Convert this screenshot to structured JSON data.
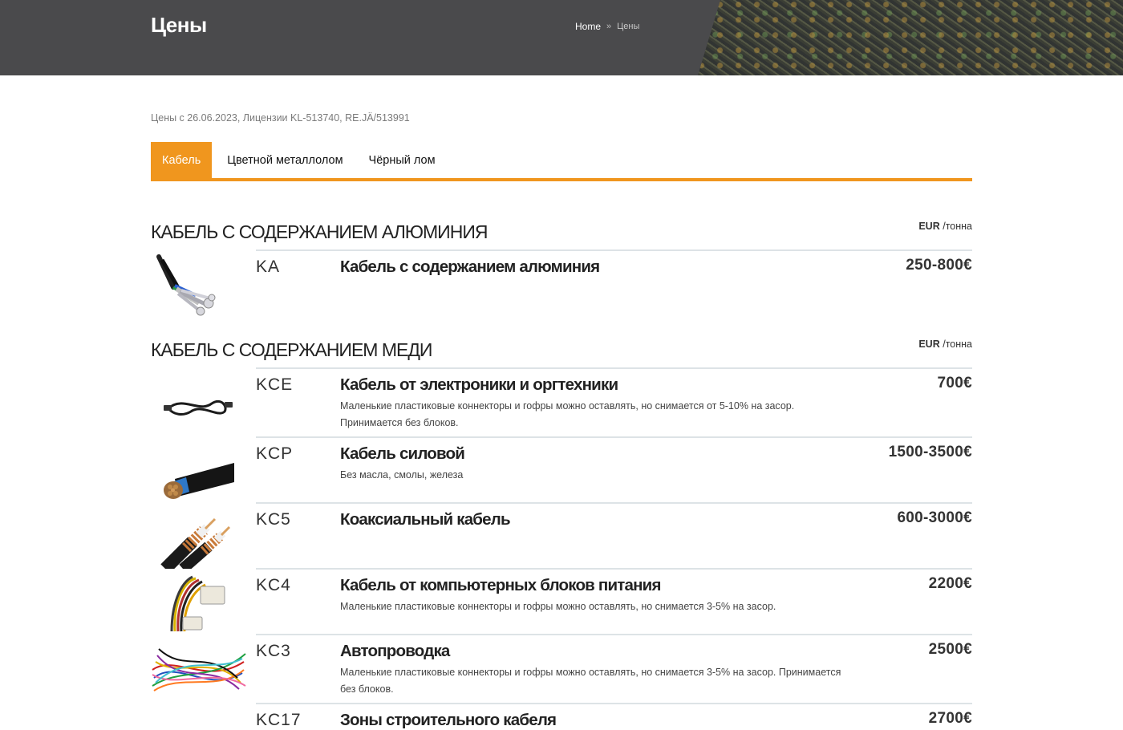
{
  "header": {
    "title": "Цены",
    "breadcrumb": {
      "home": "Home",
      "separator": "»",
      "current": "Цены"
    }
  },
  "license_text": "Цены с 26.06.2023, Лицензии KL-513740, RE.JÄ/513991",
  "tabs": [
    {
      "label": "Кабель",
      "active": true
    },
    {
      "label": "Цветной металлолом",
      "active": false
    },
    {
      "label": "Чёрный лом",
      "active": false
    }
  ],
  "colors": {
    "accent": "#f0961e",
    "header_bg": "#4a4a4c"
  },
  "sections": [
    {
      "title": "КАБЕЛЬ С СОДЕРЖАНИЕМ АЛЮМИНИЯ",
      "unit_currency": "EUR",
      "unit_per": "/тонна",
      "items": [
        {
          "code": "KA",
          "name": "Кабель с содержанием алюминия",
          "description": "",
          "price": "250-800€",
          "image": "aluminium-cable-image"
        }
      ]
    },
    {
      "title": "КАБЕЛЬ С СОДЕРЖАНИЕМ МЕДИ",
      "unit_currency": "EUR",
      "unit_per": "/тонна",
      "items": [
        {
          "code": "KCE",
          "name": "Кабель от электроники и оргтехники",
          "description": "Маленькие пластиковые коннекторы и гофры можно оставлять, но снимается от 5-10% на засор. Принимается без блоков.",
          "price": "700€",
          "image": "electronics-cable-image"
        },
        {
          "code": "KCP",
          "name": "Кабель силовой",
          "description": "Без масла, смолы, железа",
          "price": "1500-3500€",
          "image": "power-cable-image"
        },
        {
          "code": "KC5",
          "name": "Коаксиальный кабель",
          "description": "",
          "price": "600-3000€",
          "image": "coaxial-cable-image"
        },
        {
          "code": "KC4",
          "name": "Кабель от компьютерных блоков питания",
          "description": "Маленькие пластиковые коннекторы и гофры можно оставлять, но снимается 3-5% на засор.",
          "price": "2200€",
          "image": "psu-cable-image"
        },
        {
          "code": "KC3",
          "name": "Автопроводка",
          "description": "Маленькие пластиковые коннекторы и гофры можно оставлять, но снимается 3-5% на засор. Принимается без блоков.",
          "price": "2500€",
          "image": "car-wiring-image"
        },
        {
          "code": "KC17",
          "name": "Зоны строительного кабеля",
          "description": "",
          "price": "2700€",
          "image": "construction-cable-image"
        }
      ]
    }
  ]
}
